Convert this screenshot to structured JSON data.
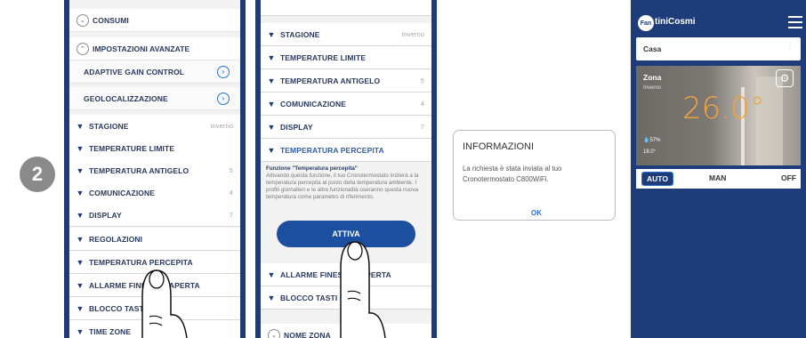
{
  "step": "2",
  "screen1": {
    "rows": [
      {
        "label": "CONSUMI",
        "value": ""
      },
      {
        "label": "IMPOSTAZIONI AVANZATE",
        "value": ""
      },
      {
        "label": "ADAPTIVE GAIN CONTROL",
        "value": ""
      },
      {
        "label": "GEOLOCALIZZAZIONE",
        "value": ""
      },
      {
        "label": "STAGIONE",
        "value": "Inverno"
      },
      {
        "label": "TEMPERATURE LIMITE",
        "value": ""
      },
      {
        "label": "TEMPERATURA ANTIGELO",
        "value": "5"
      },
      {
        "label": "COMUNICAZIONE",
        "value": "4"
      },
      {
        "label": "DISPLAY",
        "value": "7"
      },
      {
        "label": "REGOLAZIONI",
        "value": ""
      },
      {
        "label": "TEMPERATURA PERCEPITA",
        "value": ""
      },
      {
        "label": "ALLARME FINESTRA APERTA",
        "value": ""
      },
      {
        "label": "BLOCCO TASTI",
        "value": ""
      },
      {
        "label": "TIME ZONE",
        "value": ""
      }
    ]
  },
  "screen2": {
    "rows": [
      {
        "label": "STAGIONE",
        "value": "Inverno"
      },
      {
        "label": "TEMPERATURE LIMITE",
        "value": ""
      },
      {
        "label": "TEMPERATURA ANTIGELO",
        "value": "5"
      },
      {
        "label": "COMUNICAZIONE",
        "value": "4"
      },
      {
        "label": "DISPLAY",
        "value": "7"
      },
      {
        "label": "TEMPERATURA PERCEPITA",
        "value": ""
      }
    ],
    "description_title": "Funzione \"Temperatura percepita\"",
    "description_body": "Attivando questa funzione, il tuo Cronotermostato inizierà a la temperatura percepita al posto della temperatura ambiente. I profili giornalieri e le altre funzionalità useranno questa nuova temperatura come parametro di riferimento.",
    "button_label": "ATTIVA",
    "rows_after": [
      {
        "label": "ALLARME FINESTRA APERTA",
        "value": ""
      },
      {
        "label": "BLOCCO TASTI",
        "value": ""
      }
    ],
    "footer_row": "NOME ZONA"
  },
  "dialog": {
    "title": "INFORMAZIONI",
    "body": "La richiesta è stata inviata al tuo Cronotermostato C800WiFi.",
    "ok_label": "OK"
  },
  "screen3": {
    "logo_mark": "Fan",
    "brand": "tiniCosmi",
    "selector": "Casa",
    "selector_dots": "⋮",
    "zone_title": "Zona",
    "zone_subtitle": "Inverno",
    "temperature": "26.0°",
    "humidity": "💧57%",
    "external": "18.0°",
    "modes": [
      "AUTO",
      "MAN",
      "OFF"
    ]
  }
}
